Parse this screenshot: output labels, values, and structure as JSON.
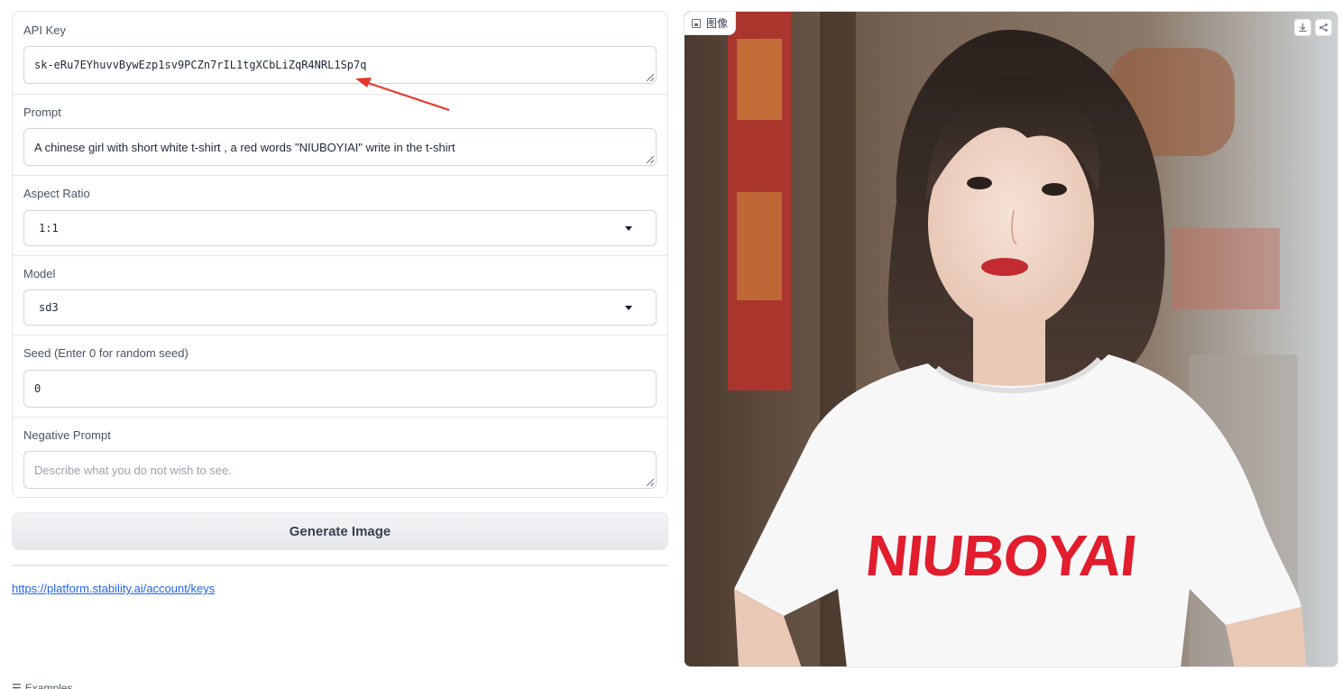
{
  "form": {
    "api_key": {
      "label": "API Key",
      "value": "sk-eRu7EYhuvvBywEzp1sv9PCZn7rIL1tgXCbLiZqR4NRL1Sp7q"
    },
    "prompt": {
      "label": "Prompt",
      "value": "A chinese girl with short white t-shirt , a red words \"NIUBOYIAI\" write in the t-shirt"
    },
    "aspect_ratio": {
      "label": "Aspect Ratio",
      "value": "1:1"
    },
    "model": {
      "label": "Model",
      "value": "sd3"
    },
    "seed": {
      "label": "Seed (Enter 0 for random seed)",
      "value": "0"
    },
    "negative_prompt": {
      "label": "Negative Prompt",
      "placeholder": "Describe what you do not wish to see."
    }
  },
  "generate_button": "Generate Image",
  "keys_link": "https://platform.stability.ai/account/keys",
  "examples_label": "Examples",
  "image_panel": {
    "tag_label": "图像",
    "tshirt_text": "NIUBOYAI",
    "actions": [
      "download-icon",
      "share-icon"
    ]
  },
  "colors": {
    "tshirt_text": "#e11d2e",
    "link": "#2563eb",
    "annotation_arrow": "#e5372c"
  }
}
